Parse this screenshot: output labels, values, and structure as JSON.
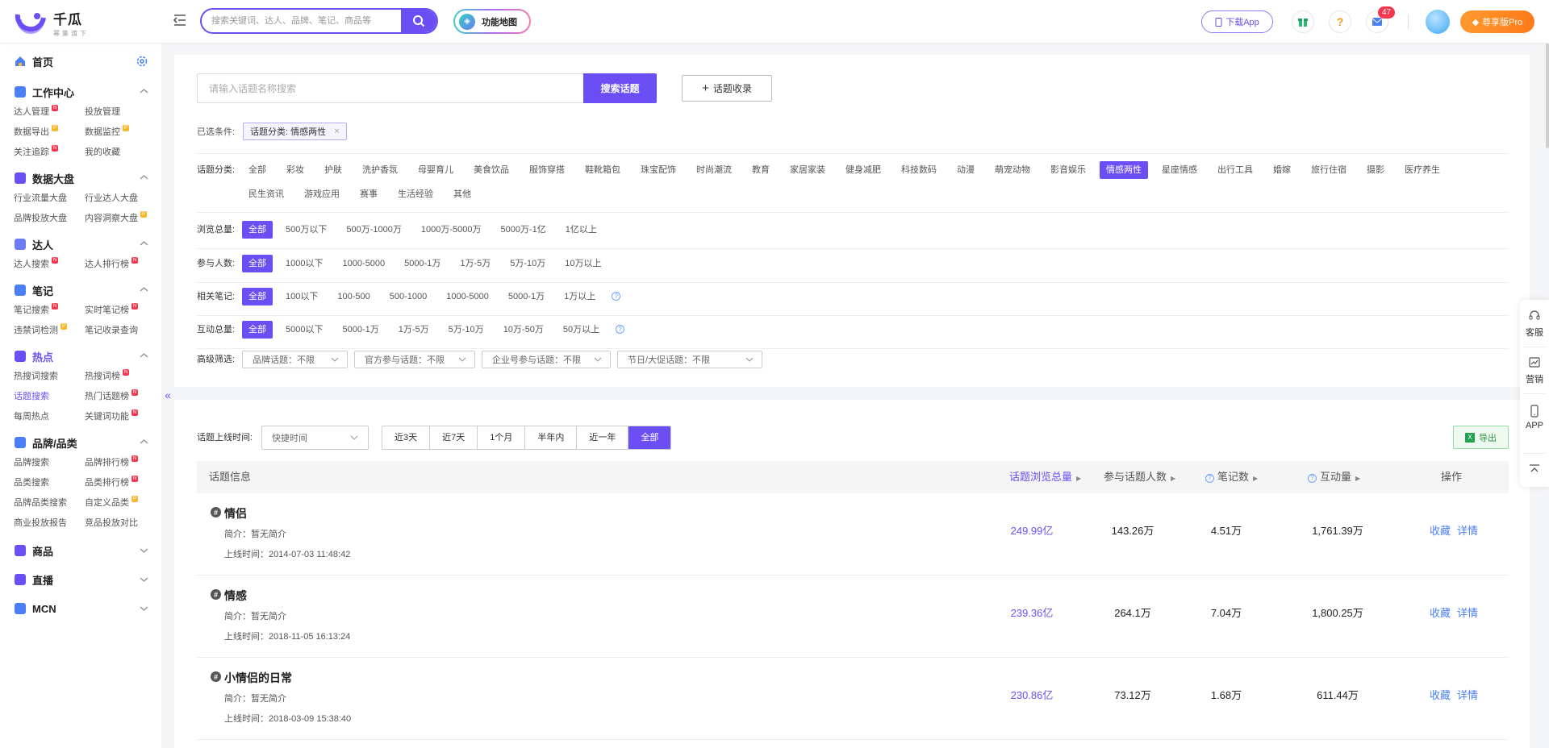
{
  "header": {
    "logo_name": "千瓜",
    "logo_sub": "幂集渡下",
    "search_placeholder": "搜索关键词、达人、品牌、笔记、商品等",
    "func_map": "功能地图",
    "download_app": "下载App",
    "mail_count": "47",
    "help_glyph": "?",
    "pro_label": "尊享版Pro",
    "accent": "#6c4ef5"
  },
  "sidebar": {
    "home": "首页",
    "groups": [
      {
        "title": "工作中心",
        "items": [
          {
            "label": "达人管理",
            "tag": "new"
          },
          {
            "label": "投放管理",
            "tag": ""
          },
          {
            "label": "数据导出",
            "tag": "pro"
          },
          {
            "label": "数据监控",
            "tag": "pro"
          },
          {
            "label": "关注追踪",
            "tag": "new"
          },
          {
            "label": "我的收藏",
            "tag": ""
          }
        ]
      },
      {
        "title": "数据大盘",
        "items": [
          {
            "label": "行业流量大盘",
            "tag": ""
          },
          {
            "label": "行业达人大盘",
            "tag": ""
          },
          {
            "label": "品牌投放大盘",
            "tag": ""
          },
          {
            "label": "内容洞察大盘",
            "tag": "pro"
          }
        ]
      },
      {
        "title": "达人",
        "items": [
          {
            "label": "达人搜索",
            "tag": "new"
          },
          {
            "label": "达人排行榜",
            "tag": "new"
          }
        ]
      },
      {
        "title": "笔记",
        "items": [
          {
            "label": "笔记搜索",
            "tag": "new"
          },
          {
            "label": "实时笔记榜",
            "tag": "new"
          },
          {
            "label": "违禁词检测",
            "tag": "pro"
          },
          {
            "label": "笔记收录查询",
            "tag": ""
          }
        ]
      },
      {
        "title": "热点",
        "active": true,
        "items": [
          {
            "label": "热搜词搜索",
            "tag": ""
          },
          {
            "label": "热搜词榜",
            "tag": "new"
          },
          {
            "label": "话题搜索",
            "tag": "",
            "active": true
          },
          {
            "label": "热门话题榜",
            "tag": "new"
          },
          {
            "label": "每周热点",
            "tag": ""
          },
          {
            "label": "关键词功能",
            "tag": "new"
          }
        ]
      },
      {
        "title": "品牌/品类",
        "items": [
          {
            "label": "品牌搜索",
            "tag": ""
          },
          {
            "label": "品牌排行榜",
            "tag": "new"
          },
          {
            "label": "品类搜索",
            "tag": ""
          },
          {
            "label": "品类排行榜",
            "tag": "new"
          },
          {
            "label": "品牌品类搜索",
            "tag": ""
          },
          {
            "label": "自定义品类",
            "tag": "pro"
          },
          {
            "label": "商业投放报告",
            "tag": ""
          },
          {
            "label": "竞品投放对比",
            "tag": ""
          }
        ]
      }
    ],
    "collapsed": [
      "商品",
      "直播",
      "MCN"
    ],
    "collapse_arrow": "«",
    "tag_new": "N",
    "tag_pro": "P"
  },
  "topic_search": {
    "placeholder": "请输入话题名称搜索",
    "button": "搜索话题",
    "collect": "话题收录"
  },
  "selected": {
    "label": "已选条件:",
    "chip": "话题分类: 情感两性",
    "close": "×"
  },
  "filters": {
    "category": {
      "label": "话题分类:",
      "options": [
        "全部",
        "彩妆",
        "护肤",
        "洗护香氛",
        "母婴育儿",
        "美食饮品",
        "服饰穿搭",
        "鞋靴箱包",
        "珠宝配饰",
        "时尚潮流",
        "教育",
        "家居家装",
        "健身减肥",
        "科技数码",
        "动漫",
        "萌宠动物",
        "影音娱乐",
        "情感两性",
        "星座情感",
        "出行工具",
        "婚嫁",
        "旅行住宿",
        "摄影",
        "医疗养生",
        "民生资讯",
        "游戏应用",
        "赛事",
        "生活经验",
        "其他"
      ],
      "active": 17
    },
    "views": {
      "label": "浏览总量:",
      "options": [
        "全部",
        "500万以下",
        "500万-1000万",
        "1000万-5000万",
        "5000万-1亿",
        "1亿以上"
      ],
      "active": 0
    },
    "participants": {
      "label": "参与人数:",
      "options": [
        "全部",
        "1000以下",
        "1000-5000",
        "5000-1万",
        "1万-5万",
        "5万-10万",
        "10万以上"
      ],
      "active": 0
    },
    "notes": {
      "label": "相关笔记:",
      "options": [
        "全部",
        "100以下",
        "100-500",
        "500-1000",
        "1000-5000",
        "5000-1万",
        "1万以上"
      ],
      "active": 0,
      "help": "?"
    },
    "interactions": {
      "label": "互动总量:",
      "options": [
        "全部",
        "5000以下",
        "5000-1万",
        "1万-5万",
        "5万-10万",
        "10万-50万",
        "50万以上"
      ],
      "active": 0,
      "help": "?"
    },
    "advanced": {
      "label": "高级筛选:",
      "selects": [
        "品牌话题：不限",
        "官方参与话题：不限",
        "企业号参与话题：不限",
        "节日/大促话题：不限"
      ]
    }
  },
  "time": {
    "label": "话题上线时间:",
    "select": "快捷时间",
    "segments": [
      "近3天",
      "近7天",
      "1个月",
      "半年内",
      "近一年",
      "全部"
    ],
    "active": 5,
    "export": "导出",
    "export_icon_text": "X"
  },
  "table": {
    "headers": {
      "info": "话题信息",
      "views": "话题浏览总量",
      "participants": "参与话题人数",
      "notes": "笔记数",
      "interactions": "互动量",
      "actions": "操作",
      "help": "?"
    },
    "intro_prefix": "简介：",
    "time_prefix": "上线时间：",
    "hash": "#",
    "rows": [
      {
        "name": "情侣",
        "intro": "暂无简介",
        "online": "2014-07-03 11:48:42",
        "views": "249.99亿",
        "participants": "143.26万",
        "notes": "4.51万",
        "interactions": "1,761.39万",
        "fav": "收藏",
        "detail": "详情"
      },
      {
        "name": "情感",
        "intro": "暂无简介",
        "online": "2018-11-05 16:13:24",
        "views": "239.36亿",
        "participants": "264.1万",
        "notes": "7.04万",
        "interactions": "1,800.25万",
        "fav": "收藏",
        "detail": "详情"
      },
      {
        "name": "小情侣的日常",
        "intro": "暂无简介",
        "online": "2018-03-09 15:38:40",
        "views": "230.86亿",
        "participants": "73.12万",
        "notes": "1.68万",
        "interactions": "611.44万",
        "fav": "收藏",
        "detail": "详情"
      }
    ]
  },
  "float": {
    "service": "客服",
    "marketing": "营销",
    "app": "APP"
  }
}
